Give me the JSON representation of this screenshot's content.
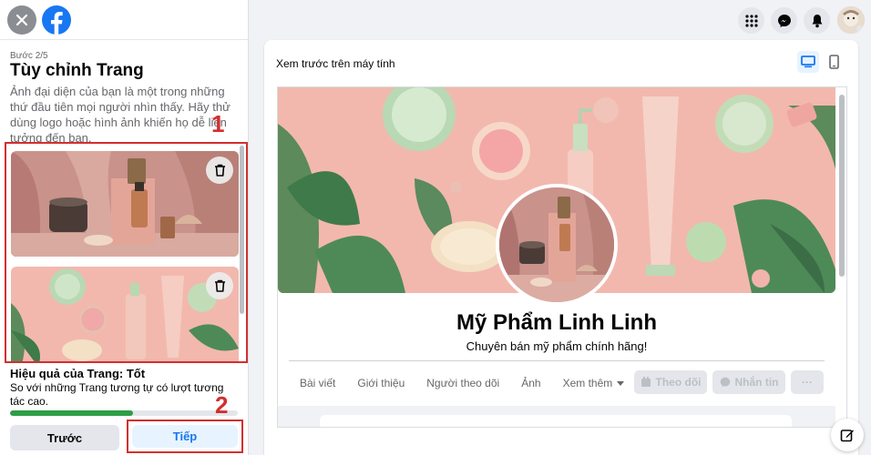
{
  "setup": {
    "step": "Bước 2/5",
    "title": "Tùy chỉnh Trang",
    "description": "Ảnh đại diện của bạn là một trong những thứ đầu tiên mọi người nhìn thấy. Hãy thử dùng logo hoặc hình ảnh khiến họ dễ liên tưởng đến bạn.",
    "annotation_1": "1",
    "annotation_2": "2",
    "performance_title": "Hiệu quả của Trang: Tốt",
    "performance_desc": "So với những Trang tương tự có lượt tương tác cao.",
    "performance_fraction": 0.54,
    "prev_label": "Trước",
    "next_label": "Tiếp"
  },
  "preview": {
    "title": "Xem trước trên máy tính",
    "page_name": "Mỹ Phẩm Linh Linh",
    "page_subtitle": "Chuyên bán mỹ phẩm chính hãng!",
    "tabs": [
      "Bài viết",
      "Giới thiệu",
      "Người theo dõi",
      "Ảnh",
      "Xem thêm"
    ],
    "follow_label": "Theo dõi",
    "message_label": "Nhắn tin",
    "more_label": "···"
  },
  "colors": {
    "brand": "#1877f2",
    "annotation": "#d32f2f",
    "progress": "#2e9e45",
    "cover_bg": "#f2b8ae"
  },
  "icons": [
    "close-icon",
    "facebook-logo",
    "trash-icon",
    "grid-menu-icon",
    "messenger-icon",
    "bell-icon",
    "desktop-icon",
    "mobile-icon",
    "edit-icon",
    "caret-down-icon"
  ]
}
